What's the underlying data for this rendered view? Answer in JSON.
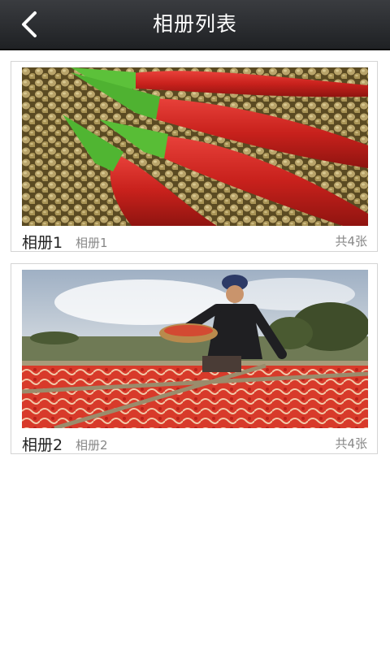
{
  "header": {
    "title": "相册列表",
    "back_icon": "back-arrow-icon"
  },
  "albums": [
    {
      "name": "相册1",
      "subtitle": "相册1",
      "count": "共4张",
      "image": "chili-peppers-on-seeds-photo"
    },
    {
      "name": "相册2",
      "subtitle": "相册2",
      "count": "共4张",
      "image": "woman-drying-chilies-photo"
    }
  ],
  "colors": {
    "header_bg": "#2a2c30",
    "card_border": "#d4d4d4",
    "muted_text": "#888888"
  }
}
